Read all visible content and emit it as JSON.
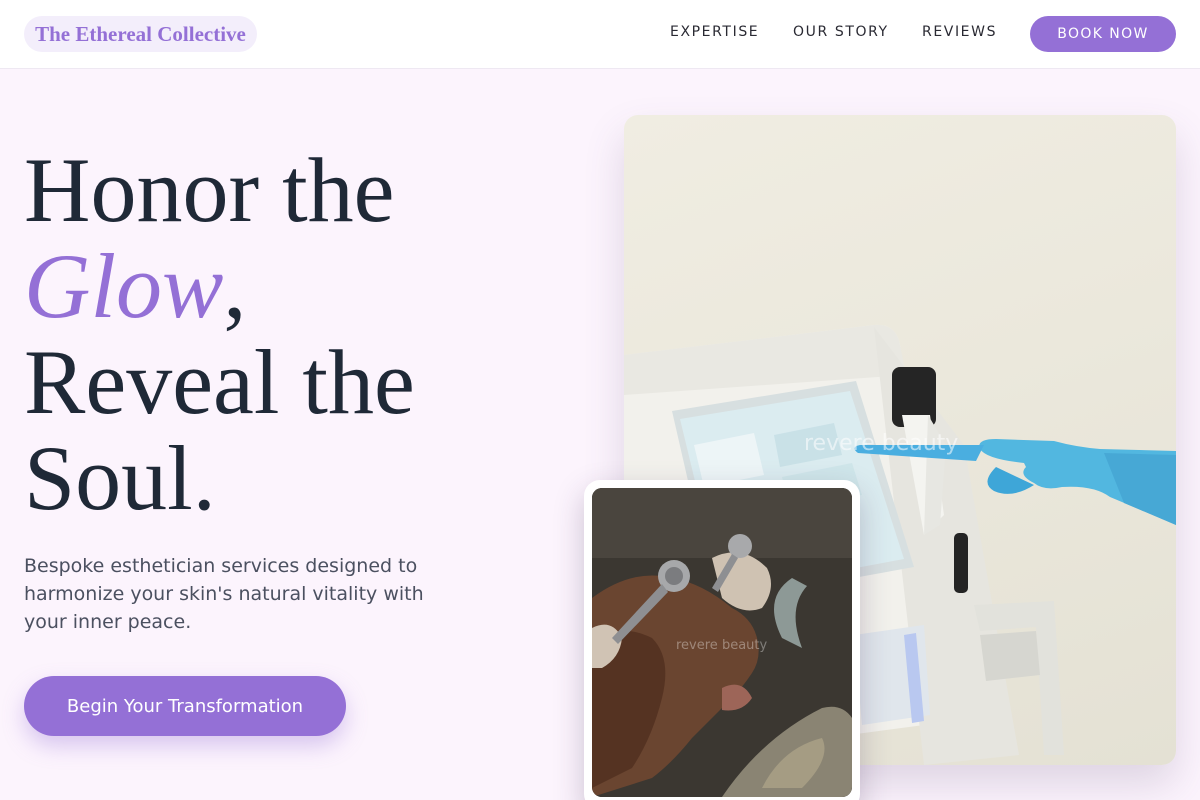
{
  "header": {
    "logo": "The Ethereal Collective",
    "nav": [
      "EXPERTISE",
      "OUR STORY",
      "REVIEWS"
    ],
    "book_label": "BOOK NOW"
  },
  "hero": {
    "line1": "Honor the",
    "glow_word": "Glow",
    "comma": ",",
    "line3": "Reveal the",
    "line4": "Soul.",
    "subtitle": "Bespoke esthetician services designed to harmonize your skin's natural vitality with your inner peace.",
    "cta_label": "Begin Your Transformation"
  },
  "images": {
    "main_alt": "Gloved hand operating skincare treatment device touchscreen",
    "main_watermark": "revere beauty",
    "inset_alt": "Client receiving facial treatment with metal tools",
    "inset_watermark": "revere beauty"
  },
  "colors": {
    "accent": "#9470d6",
    "background": "#fcf4fd",
    "text": "#1f2937"
  }
}
